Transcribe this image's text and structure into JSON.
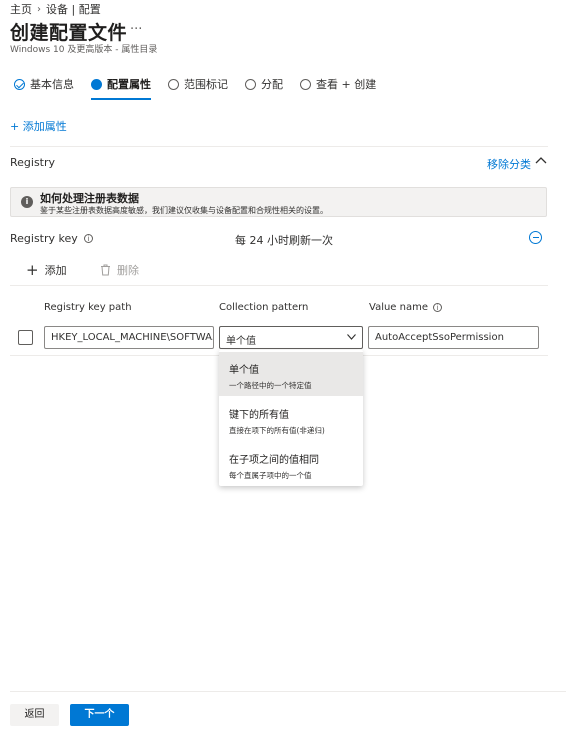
{
  "breadcrumb": {
    "home": "主页",
    "devices": "设备 | 配置"
  },
  "page": {
    "title": "创建配置文件",
    "more": "···",
    "subtitle": "Windows 10 及更高版本 - 属性目录"
  },
  "steps": [
    {
      "label": "基本信息",
      "state": "done"
    },
    {
      "label": "配置属性",
      "state": "active"
    },
    {
      "label": "范围标记",
      "state": "pending"
    },
    {
      "label": "分配",
      "state": "pending"
    },
    {
      "label": "查看 + 创建",
      "state": "pending"
    }
  ],
  "add_property": "+ 添加属性",
  "section": {
    "title": "Registry",
    "remove_category": "移除分类"
  },
  "info": {
    "title": "如何处理注册表数据",
    "description": "鉴于某些注册表数据高度敏感，我们建议仅收集与设备配置和合规性相关的设置。"
  },
  "registry_key": {
    "label": "Registry key",
    "refresh": "每 24 小时刷新一次"
  },
  "toolbar": {
    "add": "添加",
    "delete": "删除"
  },
  "table": {
    "headers": {
      "path": "Registry key path",
      "pattern": "Collection pattern",
      "value_name": "Value name"
    },
    "row": {
      "path": "HKEY_LOCAL_MACHINE\\SOFTWA...",
      "pattern": "单个值",
      "value_name": "AutoAcceptSsoPermission"
    }
  },
  "dropdown": [
    {
      "label": "单个值",
      "desc": "一个路径中的一个特定值",
      "selected": true
    },
    {
      "label": "键下的所有值",
      "desc": "直接在项下的所有值(非递归)",
      "selected": false
    },
    {
      "label": "在子项之间的值相同",
      "desc": "每个直属子项中的一个值",
      "selected": false
    }
  ],
  "footer": {
    "back": "返回",
    "next": "下一个"
  },
  "colors": {
    "accent": "#0078d4",
    "disabled": "#a19f9d"
  }
}
